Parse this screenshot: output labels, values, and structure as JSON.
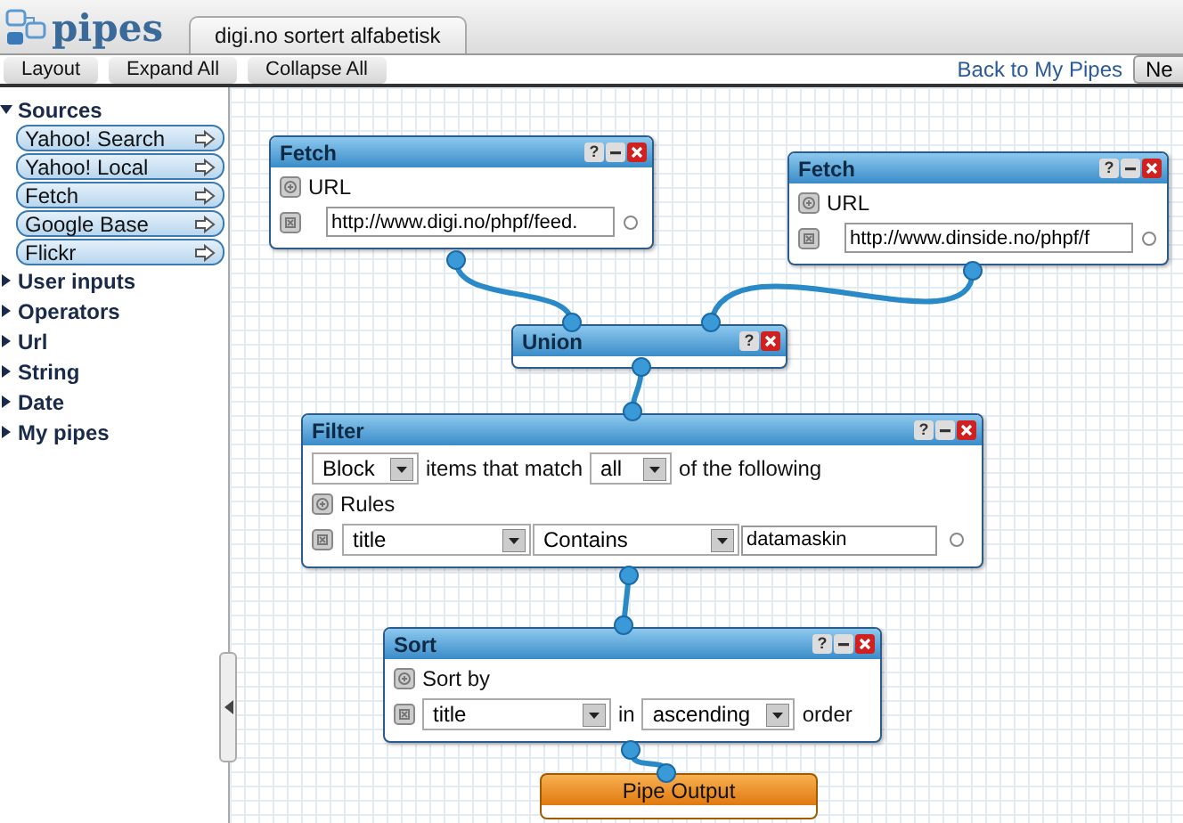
{
  "logo": {
    "text": "pipes"
  },
  "tab": {
    "label": "digi.no sortert alfabetisk",
    "selected": true
  },
  "toolbar": {
    "buttons": [
      "Layout",
      "Expand All",
      "Collapse All"
    ],
    "link": "Back to My Pipes",
    "right_button": "Ne"
  },
  "sidebar": [
    {
      "label": "Sources",
      "expanded": true,
      "items": [
        "Yahoo! Search",
        "Yahoo! Local",
        "Fetch",
        "Google Base",
        "Flickr"
      ]
    },
    {
      "label": "User inputs",
      "expanded": false
    },
    {
      "label": "Operators",
      "expanded": false
    },
    {
      "label": "Url",
      "expanded": false
    },
    {
      "label": "String",
      "expanded": false
    },
    {
      "label": "Date",
      "expanded": false
    },
    {
      "label": "My pipes",
      "expanded": false
    }
  ],
  "modules": [
    {
      "kind": "fetch",
      "title": "Fetch",
      "help": "?",
      "label": "URL",
      "value": "http://www.digi.no/phpf/feed."
    },
    {
      "kind": "fetch",
      "title": "Fetch",
      "help": "?",
      "label": "URL",
      "value": "http://www.dinside.no/phpf/f"
    },
    {
      "kind": "union",
      "title": "Union",
      "help": "?"
    },
    {
      "kind": "filter",
      "title": "Filter",
      "help": "?",
      "mode": "Block",
      "text_1": "items that match",
      "match": "all",
      "text_2": "of the following",
      "rules_label": "Rules",
      "rule_field": "title",
      "rule_op": "Contains",
      "rule_value": "datamaskin"
    },
    {
      "kind": "sort",
      "title": "Sort",
      "help": "?",
      "label": "Sort by",
      "field": "title",
      "text_1": "in",
      "direction": "ascending",
      "text_2": "order"
    },
    {
      "kind": "output",
      "title": "Pipe Output"
    }
  ]
}
